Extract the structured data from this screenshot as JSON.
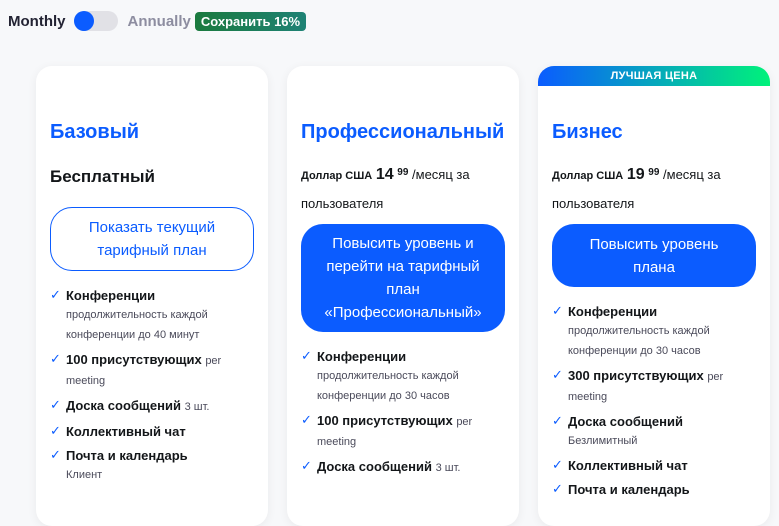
{
  "billing": {
    "monthly": "Monthly",
    "annually": "Annually",
    "save_badge": "Сохранить 16%",
    "annual_selected": false
  },
  "plans": [
    {
      "name": "Базовый",
      "price_label": "Бесплатный",
      "button": "Показать текущий тарифный план",
      "features": [
        {
          "title": "Конференции",
          "detail": "продолжительность каждой конференции до 40 минут"
        },
        {
          "title": "100 присутствующих",
          "inline": "per",
          "detail": "meeting"
        },
        {
          "title": "Доска сообщений",
          "inline": "3 шт."
        },
        {
          "title": "Коллективный чат"
        },
        {
          "title": "Почта и календарь",
          "detail": "Клиент"
        }
      ]
    },
    {
      "name": "Профессиональный",
      "currency": "Доллар США",
      "price_int": "14",
      "price_cents": "99",
      "per": "/месяц за пользователя",
      "button": "Повысить уровень и перейти на тарифный план «Профессиональный»",
      "features": [
        {
          "title": "Конференции",
          "detail": "продолжительность каждой конференции до 30 часов"
        },
        {
          "title": "100 присутствующих",
          "inline": "per",
          "detail": "meeting"
        },
        {
          "title": "Доска сообщений",
          "inline": "3 шт."
        }
      ]
    },
    {
      "badge": "ЛУЧШАЯ ЦЕНА",
      "name": "Бизнес",
      "currency": "Доллар США",
      "price_int": "19",
      "price_cents": "99",
      "per": "/месяц за пользователя",
      "button": "Повысить уровень плана",
      "features": [
        {
          "title": "Конференции",
          "detail": "продолжительность каждой конференции до 30 часов"
        },
        {
          "title": "300 присутствующих",
          "inline": "per",
          "detail": "meeting"
        },
        {
          "title": "Доска сообщений",
          "detail": "Безлимитный"
        },
        {
          "title": "Коллективный чат"
        },
        {
          "title": "Почта и календарь"
        }
      ]
    }
  ],
  "check_icon": "✓",
  "colors": {
    "accent": "#0b5cff",
    "save": "#1b7a3e"
  }
}
